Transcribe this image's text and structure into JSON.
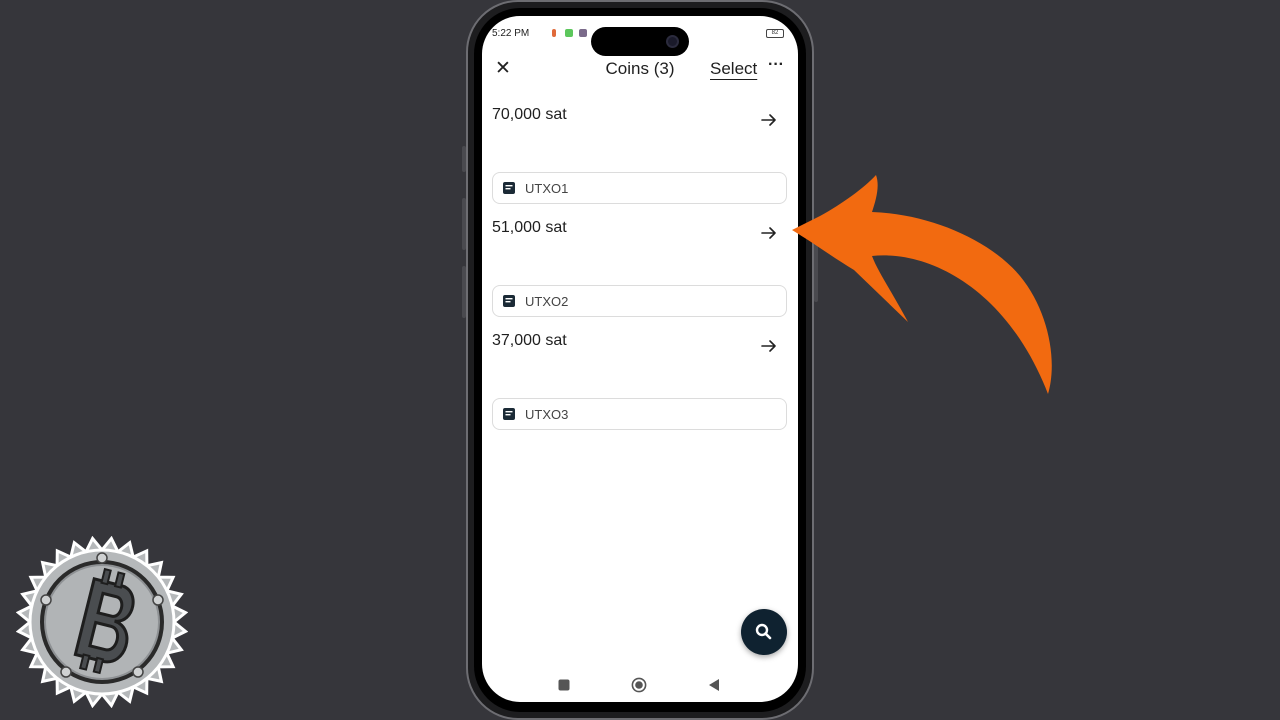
{
  "status_bar": {
    "time": "5:22 PM",
    "battery": "82"
  },
  "header": {
    "title": "Coins (3)",
    "select_label": "Select",
    "more_label": "···",
    "close_label": "✕"
  },
  "coins": [
    {
      "amount": "70,000 sat",
      "label": "UTXO1"
    },
    {
      "amount": "51,000 sat",
      "label": "UTXO2"
    },
    {
      "amount": "37,000 sat",
      "label": "UTXO3"
    }
  ],
  "colors": {
    "background": "#36363b",
    "fab": "#0f2230",
    "annotation_arrow": "#f26a10",
    "logo": "#b5b8ba"
  },
  "icons": {
    "close": "close-icon",
    "more": "more-horizontal-icon",
    "coin_arrow": "arrow-right-icon",
    "label": "note-icon",
    "fab": "search-icon",
    "nav": [
      "square-icon",
      "circle-home-icon",
      "back-triangle-icon"
    ],
    "logo": "bitcoin-gear-logo",
    "annotation": "curved-arrow-icon"
  }
}
